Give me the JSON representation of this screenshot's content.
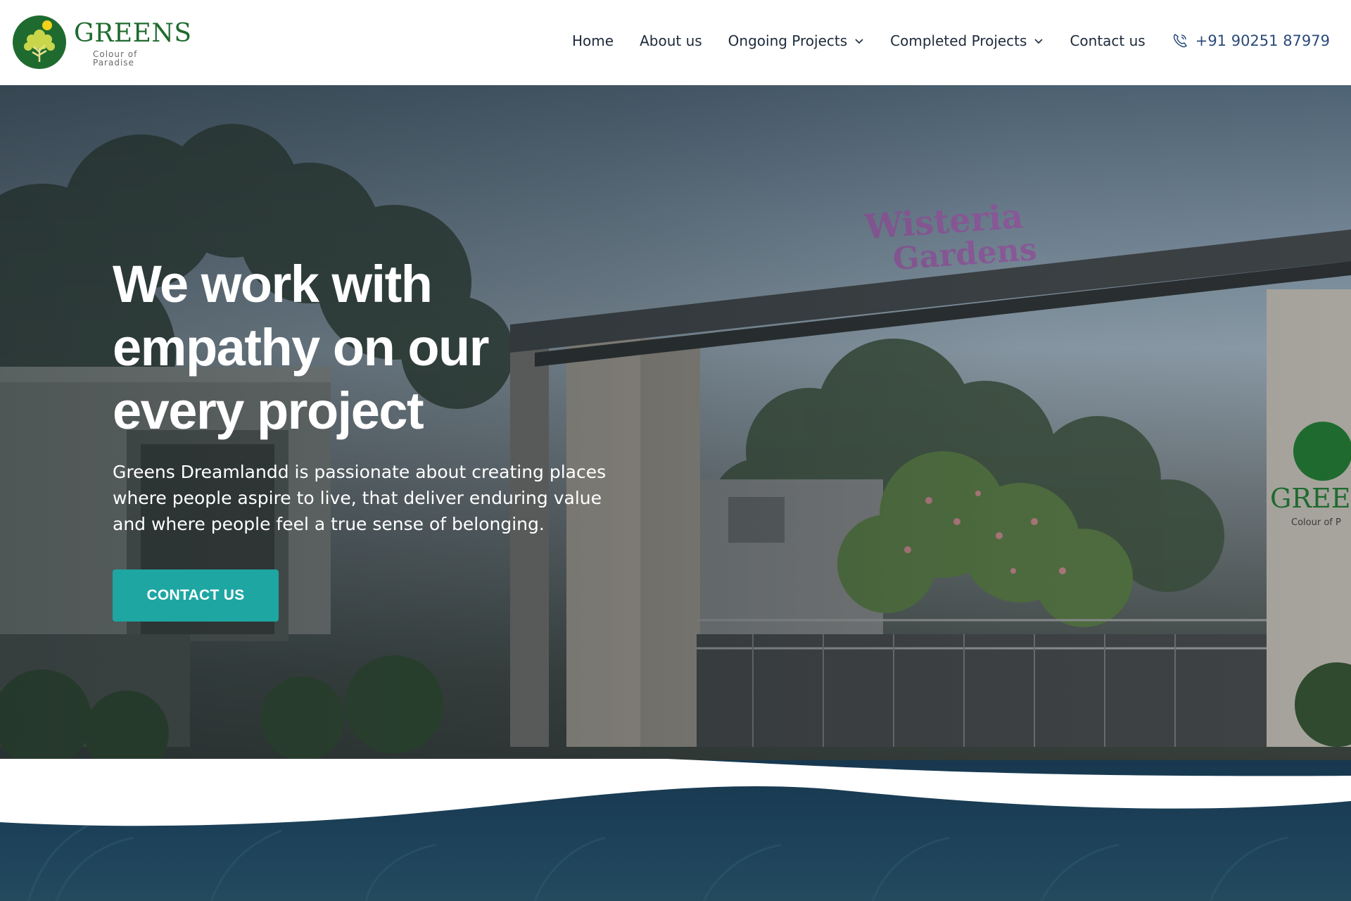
{
  "brand": {
    "name": "GREENS",
    "tagline": "Colour of Paradise",
    "colors": {
      "primary_green": "#1f6b2f",
      "accent_teal": "#1ea6a3",
      "nav_text": "#1d2a3a",
      "dark_band": "#17384f"
    }
  },
  "nav": {
    "items": [
      {
        "label": "Home",
        "dropdown": false
      },
      {
        "label": "About us",
        "dropdown": false
      },
      {
        "label": "Ongoing Projects",
        "dropdown": true
      },
      {
        "label": "Completed Projects",
        "dropdown": true
      },
      {
        "label": "Contact us",
        "dropdown": false
      }
    ],
    "phone": {
      "icon": "phone-icon",
      "label": "+91 90251 87979"
    }
  },
  "hero": {
    "title_lines": [
      "We work with",
      "empathy on our",
      "every project"
    ],
    "description": "Greens Dreamlandd is passionate about creating places where people aspire to live, that deliver enduring value and where people feel a true sense of belonging.",
    "cta_label": "CONTACT US",
    "sign_text_line1": "Wisteria",
    "sign_text_line2": "Gardens",
    "pillar_logo_text": "GREEN",
    "pillar_logo_tag": "Colour of P"
  }
}
